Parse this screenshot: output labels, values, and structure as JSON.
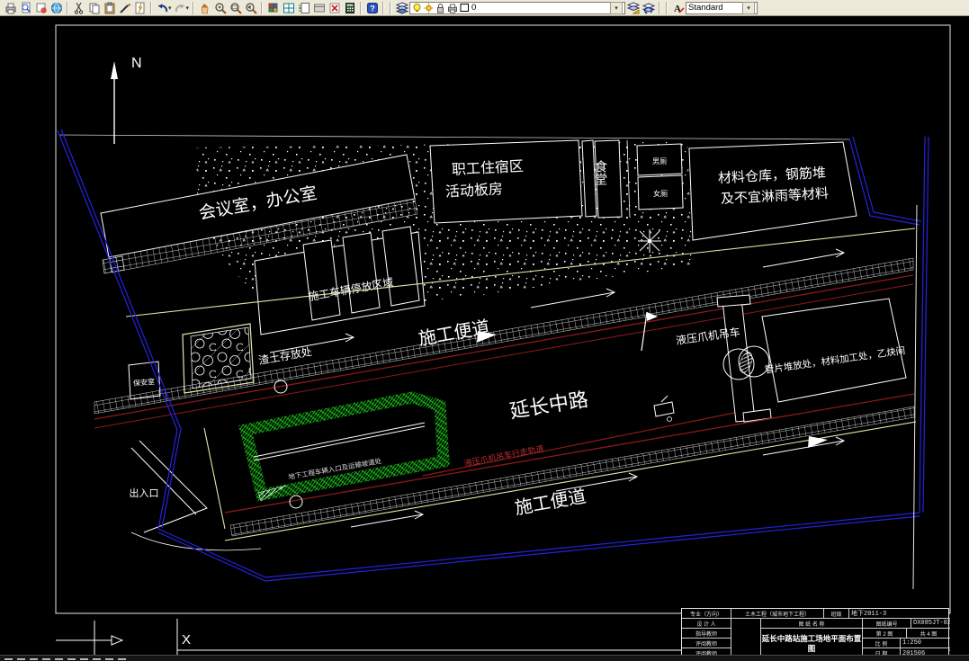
{
  "toolbar": {
    "layer_value": "0",
    "style_value": "Standard"
  },
  "canvas": {
    "labels": {
      "north": "N",
      "meeting_office": "会议室，办公室",
      "dorm1": "职工住宿区",
      "dorm2": "活动板房",
      "canteen": "食堂",
      "toilet_m": "男厕",
      "toilet_f": "女厕",
      "warehouse1": "材料仓库，钢筋堆",
      "warehouse2": "及不宜淋雨等材料",
      "parking": "施工车辆停放区域",
      "muck": "渣土存放处",
      "security": "保安室",
      "road_upper": "施工便道",
      "road_lower": "施工便道",
      "main_road": "延长中路",
      "crane": "液压爪机吊车",
      "crane_track": "液压爪机吊车行走轨道",
      "segment_yard": "管片堆放处，材料加工处，乙炔间",
      "exit": "出入口",
      "pit_note": "地下工程车辆入口及运输坡道处",
      "cursor": "X"
    },
    "colors": {
      "boundary_blue": "#2323dd",
      "road_red": "#8b1a1a",
      "pit_green": "#18c518",
      "line_yellow": "#e6e6a8"
    }
  },
  "title_block": {
    "specialty_label": "专业（方向）",
    "specialty_value": "土木工程（城市地下工程）",
    "class_label": "班级",
    "class_value": "地下2011-3",
    "designer_label": "设 计 人",
    "name_header": "图 纸 名 称",
    "number_label": "图纸编号",
    "number_value": "DX085JT-02",
    "advisor_label": "指导教师",
    "sheet_no": "第 2 图",
    "sheet_total": "共 4 图",
    "reviewer_label": "评阅教师",
    "reviewer2_label": "评阅教师",
    "scale_label": "比 例",
    "scale_value": "1:250",
    "date_label": "日 期",
    "date_value": "201506",
    "drawing_name": "延长中路站施工场地平面布置图"
  }
}
